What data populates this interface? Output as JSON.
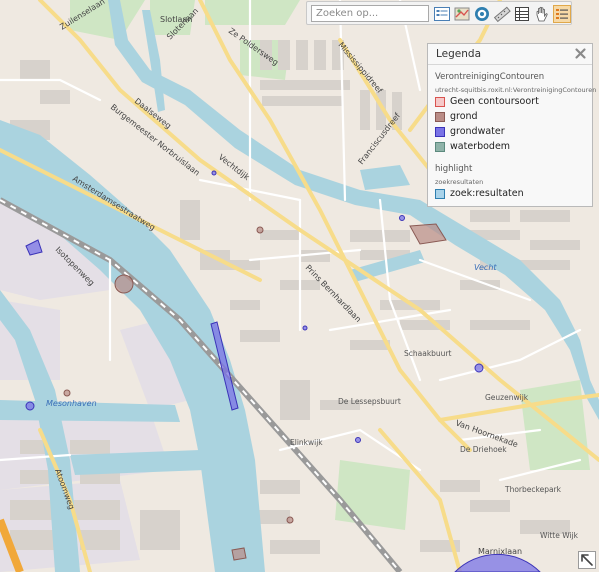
{
  "toolbar": {
    "search_placeholder": "Zoeken op...",
    "icons": [
      "list-icon",
      "map-icon",
      "target-icon",
      "ruler-icon",
      "table-icon",
      "hand-icon",
      "layers-icon"
    ]
  },
  "legend": {
    "title": "Legenda",
    "layers": [
      {
        "name": "VerontreinigingContouren",
        "source": "utrecht-squitbis.roxit.nl:VerontreinigingContouren",
        "items": [
          {
            "label": "Geen contoursoort",
            "fill": "#f6c9c9",
            "border": "#d9534f"
          },
          {
            "label": "grond",
            "fill": "#b98c86",
            "border": "#8a5a54"
          },
          {
            "label": "grondwater",
            "fill": "#7a73e6",
            "border": "#3b33b8"
          },
          {
            "label": "waterbodem",
            "fill": "#8fb3a9",
            "border": "#5c8a7e"
          }
        ]
      },
      {
        "name": "highlight",
        "source": "zoekresultaten",
        "items": [
          {
            "label": "zoek:resultaten",
            "fill": "#a9d3ea",
            "border": "#2f7fb0"
          }
        ]
      }
    ]
  },
  "map": {
    "streets": [
      "Zuilenselaan",
      "Slotlaan",
      "Sloterlaan",
      "Ze Poldersweg",
      "Mississippidreef",
      "Franciscusdreef",
      "Daalseweg",
      "Burgemeester Norbruislaan",
      "Vechtdijk",
      "Amsterdamsestraatweg",
      "Isotopenweg",
      "Prins Bernhardlaan",
      "Schaakbuurt",
      "Geuzenwijk",
      "De Lessepsbuurt",
      "Van Hoornekade",
      "De Driehoek",
      "Elinkwijk",
      "Thorbeckepark",
      "Atoomweg",
      "Marnixlaan",
      "Witte Wijk"
    ],
    "water_labels": [
      "Vecht",
      "Mesonhaven"
    ],
    "colors": {
      "land": "#efe9e1",
      "water": "#aad3df",
      "canal": "#5aa5d6",
      "major_road": "#f7dc8a",
      "motorway": "#f1a83a"
    }
  },
  "nav": {
    "corner_arrow": "arrow-up-left-icon"
  }
}
